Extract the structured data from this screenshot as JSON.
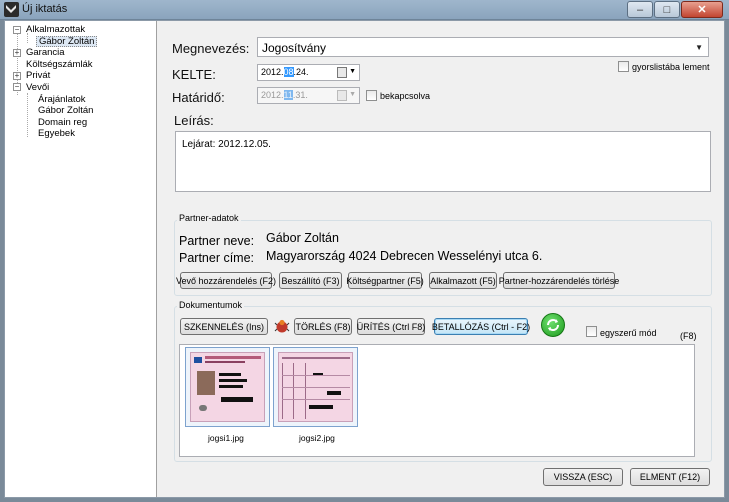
{
  "window": {
    "title": "Új iktatás",
    "minimize_glyph": "–",
    "maximize_glyph": "□",
    "close_glyph": "✕"
  },
  "tree": {
    "items": [
      {
        "label": "Alkalmazottak",
        "expander": "−"
      },
      {
        "label": "Gábor Zoltán",
        "selected": true
      },
      {
        "label": "Garancia",
        "expander": "+"
      },
      {
        "label": "Költségszámlák"
      },
      {
        "label": "Privát",
        "expander": "+"
      },
      {
        "label": "Vevői",
        "expander": "−"
      },
      {
        "label": "Árajánlatok"
      },
      {
        "label": "Gábor Zoltán"
      },
      {
        "label": "Domain reg"
      },
      {
        "label": "Egyebek"
      }
    ]
  },
  "form": {
    "megnevezes_label": "Megnevezés:",
    "megnevezes_value": "Jogosítvány",
    "gyorslista_label": "gyorslistába lement",
    "kelte_label": "KELTE:",
    "kelte_year": "2012.",
    "kelte_month": "08",
    "kelte_day": ".24.",
    "hatarido_label": "Határidő:",
    "hatarido_year": "2012.",
    "hatarido_month": "11",
    "hatarido_day": ".31.",
    "bekapcsolva_label": "bekapcsolva",
    "leiras_label": "Leírás:",
    "leiras_value": "Lejárat: 2012.12.05."
  },
  "partner": {
    "group_title": "Partner-adatok",
    "name_label": "Partner neve:",
    "name_value": "Gábor Zoltán",
    "address_label": "Partner címe:",
    "address_value": "Magyarország 4024 Debrecen Wesselényi utca 6.",
    "buttons": [
      "Vevő hozzárendelés (F2)",
      "Beszállító (F3)",
      "Költségpartner (F5)",
      "Alkalmazott (F5)",
      "Partner-hozzárendelés törlése"
    ]
  },
  "documents": {
    "group_title": "Dokumentumok",
    "scan_label": "SZKENNELÉS (Ins)",
    "delete_label": "TÖRLÉS (F8)",
    "clear_label": "ÜRÍTÉS (Ctrl F8)",
    "align_label": "BETALLÓZÁS (Ctrl - F2)",
    "simple_mode_label": "egyszerű mód",
    "f8_hint": "(F8)",
    "files": [
      "jogsi1.jpg",
      "jogsi2.jpg"
    ]
  },
  "footer": {
    "back_label": "VISSZA (ESC)",
    "save_label": "ELMENT (F12)"
  }
}
